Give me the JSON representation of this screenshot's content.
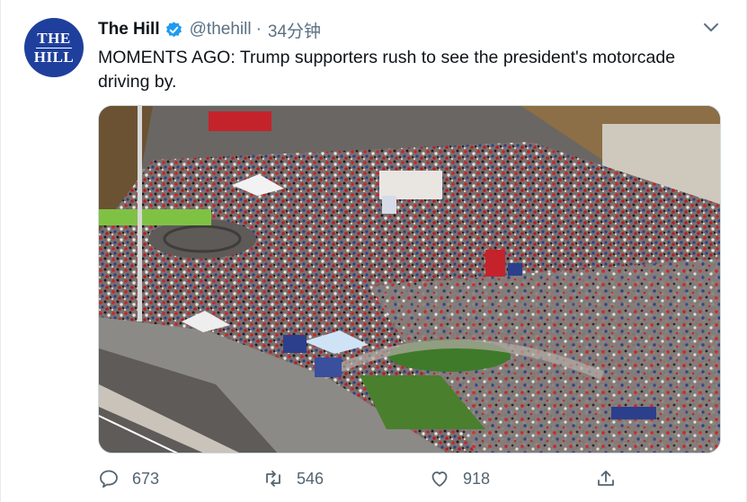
{
  "tweet": {
    "author_name": "The Hill",
    "handle": "@thehill",
    "separator": "·",
    "time": "34分钟",
    "text": "MOMENTS AGO: Trump supporters rush to see the president's motorcade driving by.",
    "avatar_text_line1": "THE",
    "avatar_text_line2": "HILL"
  },
  "actions": {
    "replies": "673",
    "retweets": "546",
    "likes": "918"
  },
  "icons": {
    "verified": "verified-badge-icon",
    "more": "chevron-down-icon",
    "reply": "reply-icon",
    "retweet": "retweet-icon",
    "like": "heart-icon",
    "share": "share-icon"
  },
  "colors": {
    "accent": "#1d9bf0",
    "muted": "#5b7083",
    "avatar_bg": "#1f3f9c"
  }
}
